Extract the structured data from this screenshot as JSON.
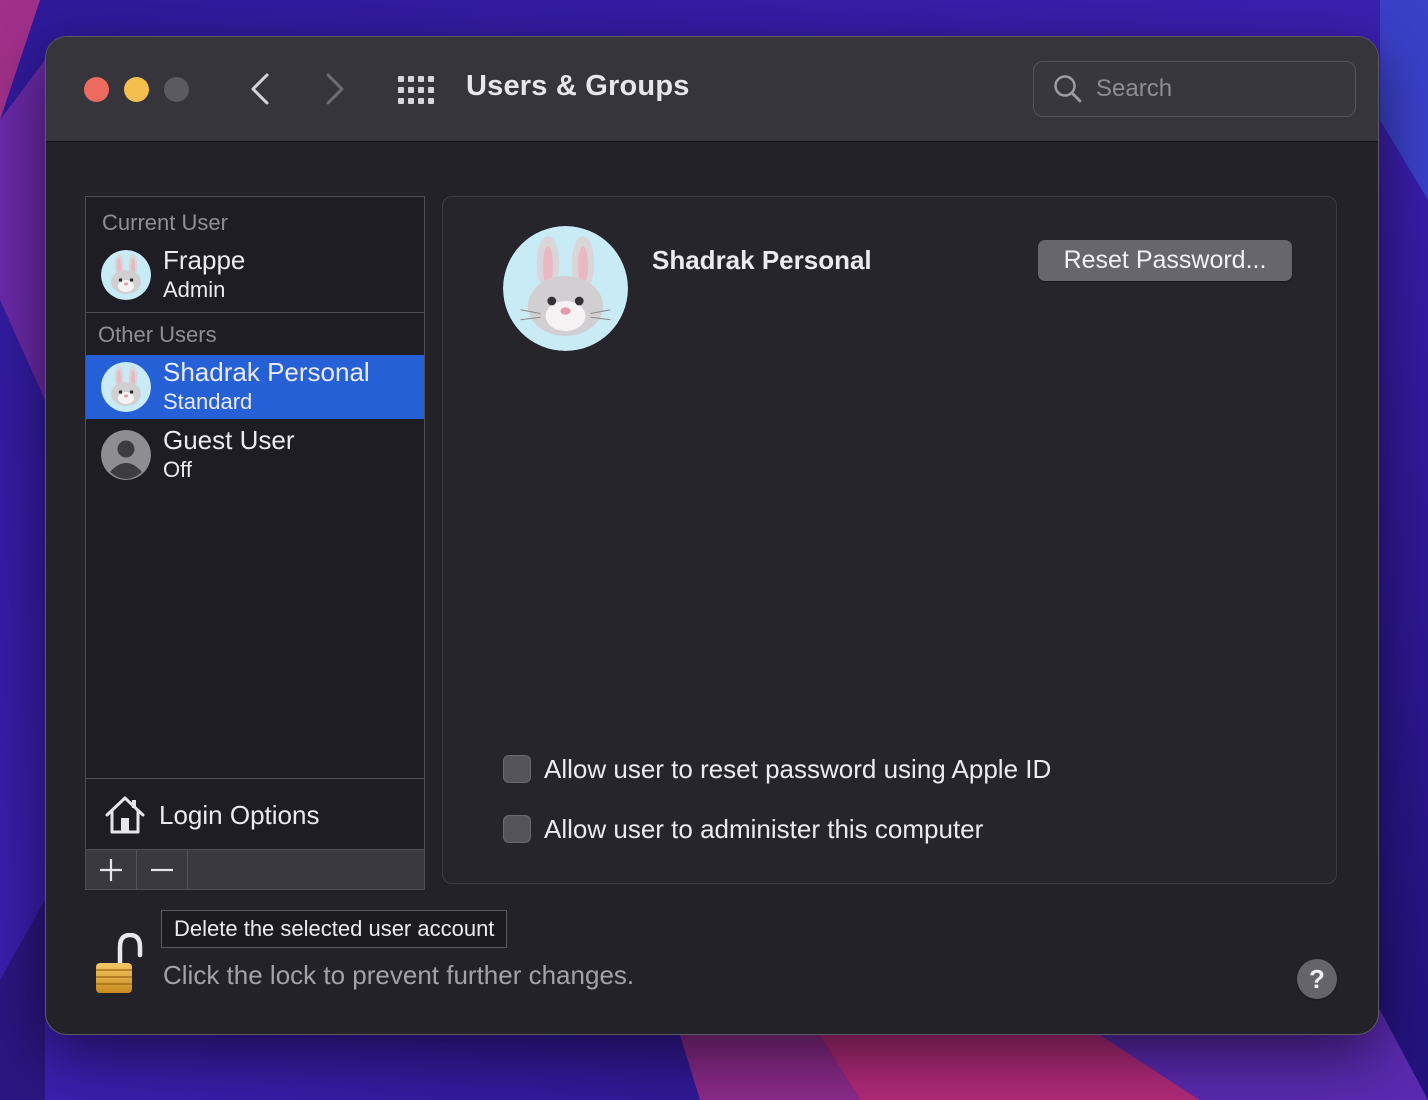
{
  "window": {
    "title": "Users & Groups",
    "search_placeholder": "Search"
  },
  "sidebar": {
    "current_user_label": "Current User",
    "current_user": {
      "name": "Frappe",
      "role": "Admin",
      "avatar": "bunny-memoji"
    },
    "other_users_label": "Other Users",
    "other_users": [
      {
        "name": "Shadrak Personal",
        "role": "Standard",
        "avatar": "bunny-memoji",
        "selected": true
      },
      {
        "name": "Guest User",
        "role": "Off",
        "avatar": "generic-person-icon",
        "selected": false
      }
    ],
    "login_options_label": "Login Options",
    "add_symbol": "+",
    "remove_symbol": "−"
  },
  "detail": {
    "user_name": "Shadrak Personal",
    "reset_password_label": "Reset Password...",
    "checkbox_reset_apple_id": {
      "label": "Allow user to reset password using Apple ID",
      "checked": false
    },
    "checkbox_administer": {
      "label": "Allow user to administer this computer",
      "checked": false
    }
  },
  "footer": {
    "tooltip": "Delete the selected user account",
    "lock_message": "Click the lock to prevent further changes.",
    "lock_state": "unlocked",
    "help_symbol": "?"
  },
  "colors": {
    "selection": "#2660d6",
    "close": "#ed6a5e",
    "minimize": "#f5bf4f",
    "avatar_background": "#c8ebf6"
  }
}
